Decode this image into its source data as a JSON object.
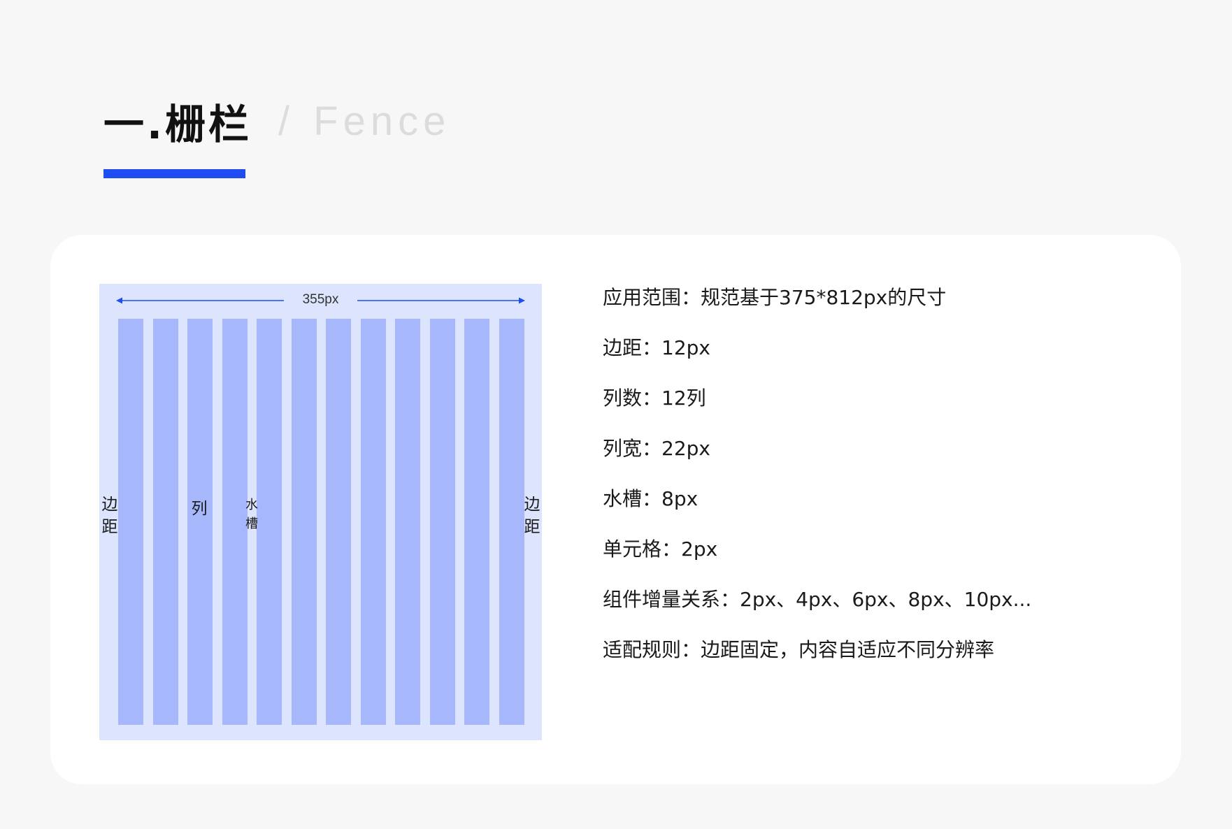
{
  "header": {
    "title_cn": "一.栅栏",
    "separator": "/",
    "title_en": "Fence",
    "accent_color": "#1f4df2"
  },
  "diagram": {
    "width_label": "355px",
    "column_count": 12,
    "labels": {
      "margin_left": [
        "边",
        "距"
      ],
      "column": "列",
      "gutter": [
        "水",
        "槽"
      ],
      "margin_right": [
        "边",
        "距"
      ]
    },
    "colors": {
      "background": "#dde4fd",
      "column": "#a6b8fb",
      "arrow": "#1f4df2"
    }
  },
  "specs": [
    "应用范围：规范基于375*812px的尺寸",
    "边距：12px",
    "列数：12列",
    "列宽：22px",
    "水槽：8px",
    "单元格：2px",
    "组件增量关系：2px、4px、6px、8px、10px...",
    "适配规则：边距固定，内容自适应不同分辨率"
  ]
}
